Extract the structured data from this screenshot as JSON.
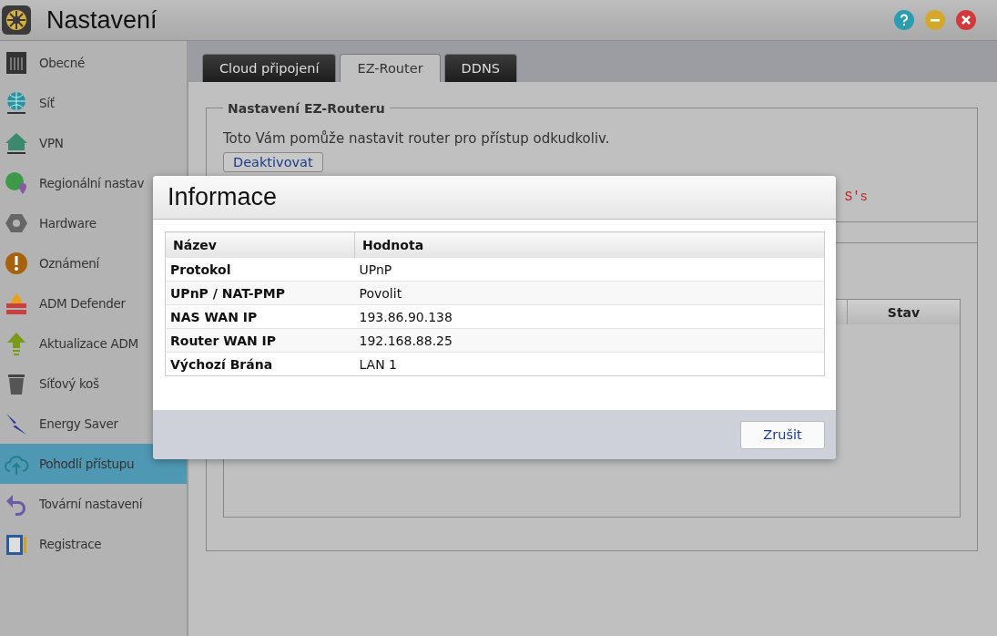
{
  "window": {
    "title": "Nastavení"
  },
  "sidebar": {
    "items": [
      {
        "label": "Obecné",
        "selected": false
      },
      {
        "label": "Síť",
        "selected": false
      },
      {
        "label": "VPN",
        "selected": false
      },
      {
        "label": "Regionální nastav",
        "selected": false
      },
      {
        "label": "Hardware",
        "selected": false
      },
      {
        "label": "Oznámení",
        "selected": false
      },
      {
        "label": "ADM Defender",
        "selected": false
      },
      {
        "label": "Aktualizace ADM",
        "selected": false
      },
      {
        "label": "Síťový koš",
        "selected": false
      },
      {
        "label": "Energy Saver",
        "selected": false
      },
      {
        "label": "Pohodlí přístupu",
        "selected": true
      },
      {
        "label": "Tovární nastavení",
        "selected": false
      },
      {
        "label": "Registrace",
        "selected": false
      }
    ]
  },
  "tabs": [
    {
      "label": "Cloud připojení",
      "selected": false
    },
    {
      "label": "EZ-Router",
      "selected": true
    },
    {
      "label": "DDNS",
      "selected": false
    }
  ],
  "section": {
    "title": "Nastavení EZ-Routeru",
    "description": "Toto Vám pomůže nastavit router pro přístup odkudkoliv.",
    "button": "Deaktivovat",
    "warning_fragment": "S's",
    "table_columns": [
      "Stav"
    ]
  },
  "dialog": {
    "title": "Informace",
    "columns": [
      "Název",
      "Hodnota"
    ],
    "rows": [
      {
        "name": "Protokol",
        "value": "UPnP"
      },
      {
        "name": "UPnP / NAT-PMP",
        "value": "Povolit"
      },
      {
        "name": "NAS WAN IP",
        "value": "193.86.90.138"
      },
      {
        "name": "Router WAN IP",
        "value": "192.168.88.25"
      },
      {
        "name": "Výchozí Brána",
        "value": "LAN 1"
      }
    ],
    "button": "Zrušit"
  }
}
